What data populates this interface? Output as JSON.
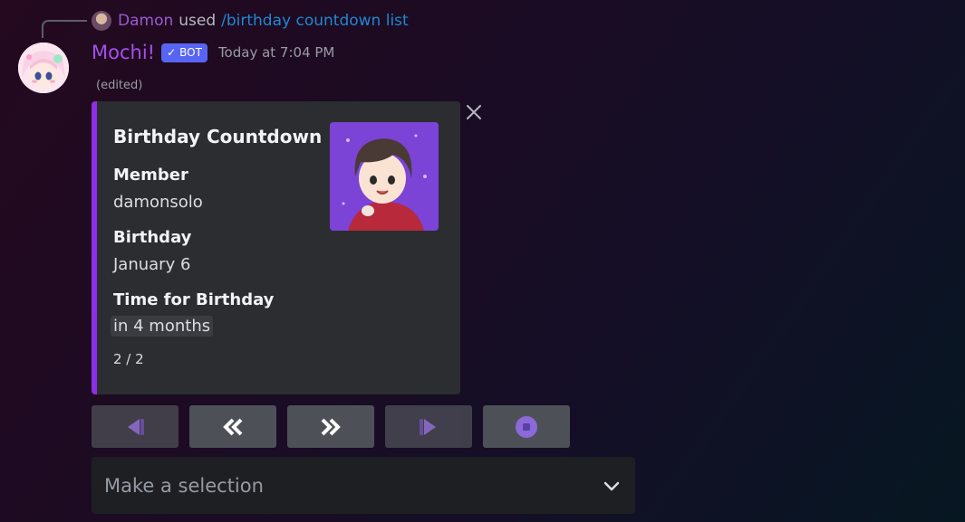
{
  "reply": {
    "user": "Damon",
    "used_label": "used",
    "command": "/birthday countdown list"
  },
  "message": {
    "username": "Mochi!",
    "bot_tag": "BOT",
    "bot_check_icon": "checkmark-icon",
    "timestamp": "Today at 7:04 PM",
    "edited": "(edited)"
  },
  "embed": {
    "accent_color": "#8e2ee6",
    "title": "Birthday Countdown",
    "fields": [
      {
        "name": "Member",
        "value": "damonsolo"
      },
      {
        "name": "Birthday",
        "value": "January 6"
      },
      {
        "name": "Time for Birthday",
        "value": "in 4 months"
      }
    ],
    "footer": "2 / 2",
    "close_icon": "close-icon"
  },
  "buttons": [
    {
      "icon": "skip-first-icon",
      "disabled": true
    },
    {
      "icon": "double-chevron-left-icon",
      "disabled": false
    },
    {
      "icon": "double-chevron-right-icon",
      "disabled": false
    },
    {
      "icon": "skip-last-icon",
      "disabled": true
    },
    {
      "icon": "stop-icon",
      "disabled": false
    }
  ],
  "select": {
    "placeholder": "Make a selection",
    "icon": "chevron-down-icon"
  },
  "colors": {
    "username": "#a64ef0",
    "reply_user": "#9b59d0",
    "command": "#1e88d0",
    "bot_tag": "#5865f2",
    "button_bg": "#4e5058",
    "icon_purple": "#a985f0"
  }
}
